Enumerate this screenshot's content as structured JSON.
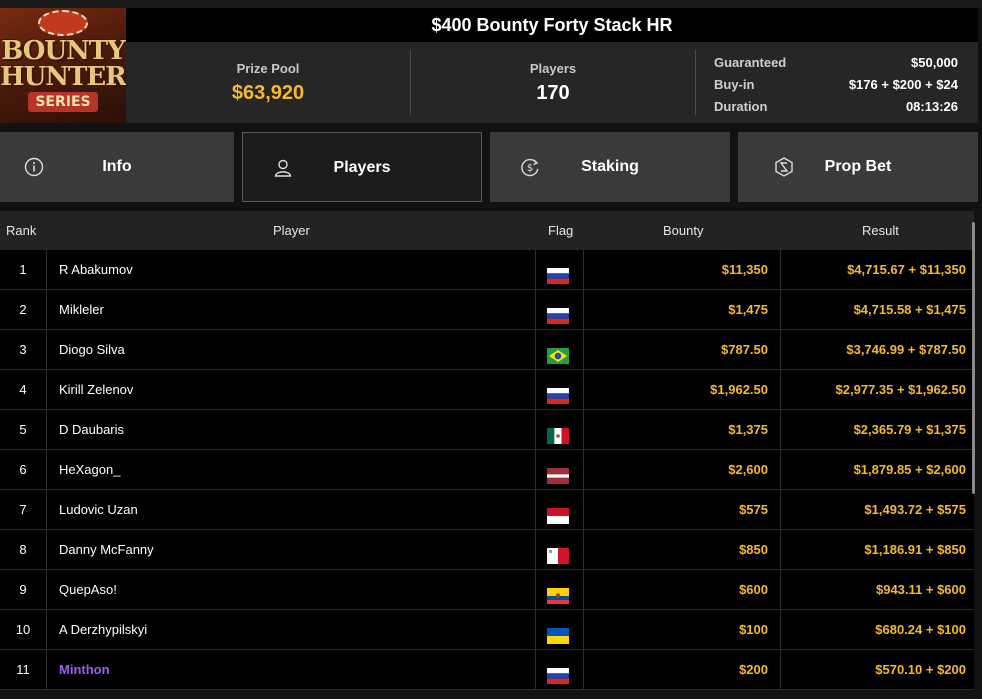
{
  "tournament": {
    "title": "$400 Bounty Forty Stack HR",
    "logo_text": [
      "BOUNTY",
      "HUNTERS",
      "SERIES"
    ],
    "prize_pool_label": "Prize Pool",
    "prize_pool": "$63,920",
    "players_label": "Players",
    "players": "170",
    "details": [
      {
        "key": "Guaranteed",
        "value": "$50,000"
      },
      {
        "key": "Buy-in",
        "value": "$176 + $200 + $24"
      },
      {
        "key": "Duration",
        "value": "08:13:26"
      }
    ]
  },
  "tabs": [
    {
      "label": "Info",
      "icon": "info-icon",
      "active": false
    },
    {
      "label": "Players",
      "icon": "user-icon",
      "active": true
    },
    {
      "label": "Staking",
      "icon": "dollar-cycle-icon",
      "active": false
    },
    {
      "label": "Prop Bet",
      "icon": "prop-bet-icon",
      "active": false
    }
  ],
  "table": {
    "headers": {
      "rank": "Rank",
      "player": "Player",
      "flag": "Flag",
      "bounty": "Bounty",
      "result": "Result"
    },
    "rows": [
      {
        "rank": "1",
        "player": "R Abakumov",
        "flag": "russia",
        "bounty": "$11,350",
        "result": "$4,715.67 + $11,350"
      },
      {
        "rank": "2",
        "player": "Mikleler",
        "flag": "russia",
        "bounty": "$1,475",
        "result": "$4,715.58 + $1,475"
      },
      {
        "rank": "3",
        "player": "Diogo Silva",
        "flag": "brazil",
        "bounty": "$787.50",
        "result": "$3,746.99 + $787.50"
      },
      {
        "rank": "4",
        "player": "Kirill Zelenov",
        "flag": "russia",
        "bounty": "$1,962.50",
        "result": "$2,977.35 + $1,962.50"
      },
      {
        "rank": "5",
        "player": "D Daubaris",
        "flag": "mexico",
        "bounty": "$1,375",
        "result": "$2,365.79 + $1,375"
      },
      {
        "rank": "6",
        "player": "HeXagon_",
        "flag": "latvia",
        "bounty": "$2,600",
        "result": "$1,879.85 + $2,600"
      },
      {
        "rank": "7",
        "player": "Ludovic Uzan",
        "flag": "monaco",
        "bounty": "$575",
        "result": "$1,493.72 + $575"
      },
      {
        "rank": "8",
        "player": "Danny McFanny",
        "flag": "malta",
        "bounty": "$850",
        "result": "$1,186.91 + $850"
      },
      {
        "rank": "9",
        "player": "QuepAso!",
        "flag": "ecuador",
        "bounty": "$600",
        "result": "$943.11 + $600"
      },
      {
        "rank": "10",
        "player": "A Derzhypilskyi",
        "flag": "ukraine",
        "bounty": "$100",
        "result": "$680.24 + $100"
      },
      {
        "rank": "11",
        "player": "Minthon",
        "flag": "russia",
        "bounty": "$200",
        "result": "$570.10 + $200",
        "highlight": true
      }
    ]
  },
  "colors": {
    "accent": "#f5b82e",
    "highlight": "#9b5cf5",
    "active_tab": "#1c1c1c",
    "tab": "#3a3a3a"
  }
}
